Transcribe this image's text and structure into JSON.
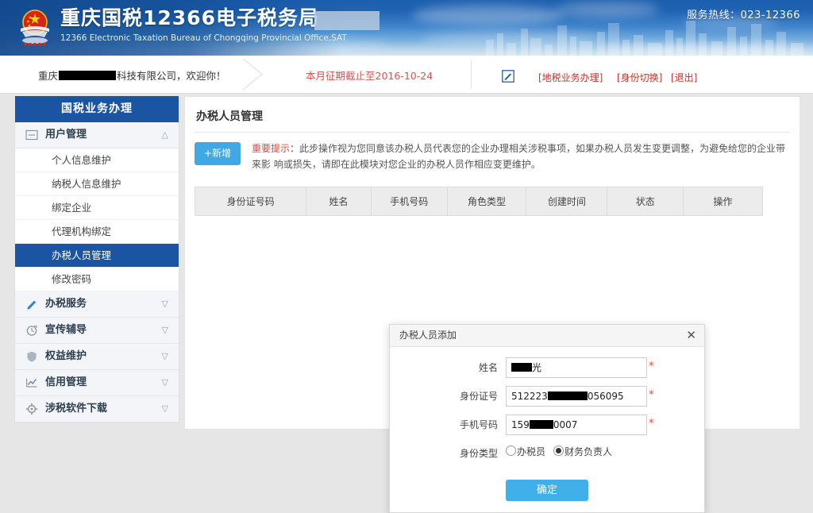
{
  "banner": {
    "title_cn": "重庆国税12366电子税务局",
    "title_en": "12366 Electronic Taxation Bureau of Chongqing Provincial Office,SAT",
    "hotline": "服务热线：023-12366",
    "emblem_alt": "national-emblem",
    "colors": {
      "blue_dark": "#1c5fae",
      "blue_light": "#d7e6f2"
    }
  },
  "userbar": {
    "welcome_prefix": "重庆",
    "welcome_suffix": "科技有限公司，欢迎你！",
    "period_notice": "本月征期截止至2016-10-24",
    "links": [
      {
        "label": "[地税业务办理]"
      },
      {
        "label": "[身份切换]"
      },
      {
        "label": "[退出]"
      }
    ],
    "link_color": "#c9302c",
    "notice_color": "#d9534f"
  },
  "sidebar": {
    "header": "国税业务办理",
    "header_color": "#1b54a3",
    "groups": [
      {
        "label": "用户管理",
        "icon": "list-box-icon",
        "arrow": "collapse-up-icon",
        "expanded": true,
        "items": [
          {
            "label": "个人信息维护",
            "active": false
          },
          {
            "label": "纳税人信息维护",
            "active": false
          },
          {
            "label": "绑定企业",
            "active": false
          },
          {
            "label": "代理机构绑定",
            "active": false
          },
          {
            "label": "办税人员管理",
            "active": true
          },
          {
            "label": "修改密码",
            "active": false
          }
        ]
      },
      {
        "label": "办税服务",
        "icon": "pencil-icon",
        "arrow": "expand-down-icon",
        "expanded": false,
        "items": []
      },
      {
        "label": "宣传辅导",
        "icon": "clock-icon",
        "arrow": "expand-down-icon",
        "expanded": false,
        "items": []
      },
      {
        "label": "权益维护",
        "icon": "shield-icon",
        "arrow": "expand-down-icon",
        "expanded": false,
        "items": []
      },
      {
        "label": "信用管理",
        "icon": "chart-icon",
        "arrow": "expand-down-icon",
        "expanded": false,
        "items": []
      },
      {
        "label": "涉税软件下载",
        "icon": "gear-icon",
        "arrow": "expand-down-icon",
        "expanded": false,
        "items": []
      }
    ]
  },
  "main": {
    "page_title": "办税人员管理",
    "add_button": "+新增",
    "notice_label": "重要提示",
    "notice_text": "：此步操作视为您同意该办税人员代表您的企业办理相关涉税事项，如果办税人员发生变更调整，为避免给您的企业带来影 响或损失，请即在此模块对您企业的办税人员作相应变更维护。",
    "table": {
      "headers": [
        "身份证号码",
        "姓名",
        "手机号码",
        "角色类型",
        "创建时间",
        "状态",
        "操作"
      ],
      "rows": []
    }
  },
  "modal": {
    "title": "办税人员添加",
    "close_icon": "close-icon",
    "fields": [
      {
        "label": "姓名",
        "value_prefix": "",
        "value_suffix": "光",
        "redact_width": 26,
        "required": true
      },
      {
        "label": "身份证号",
        "value_prefix": "512223",
        "value_suffix": "056095",
        "redact_width": 50,
        "required": true
      },
      {
        "label": "手机号码",
        "value_prefix": "159",
        "value_suffix": "0007",
        "redact_width": 30,
        "required": true
      }
    ],
    "radio_label": "身份类型",
    "radio_options": [
      {
        "label": "办税员",
        "checked": false
      },
      {
        "label": "财务负责人",
        "checked": true
      }
    ],
    "confirm_button": "确定",
    "confirm_color": "#41b0ea"
  }
}
